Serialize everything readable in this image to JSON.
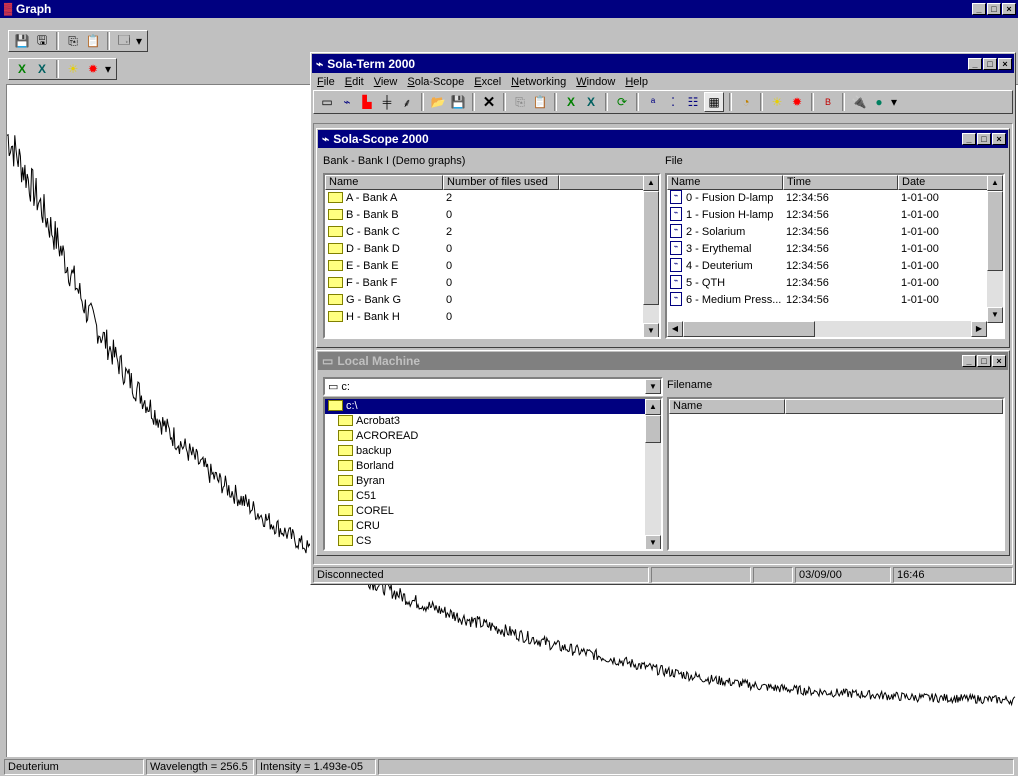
{
  "graph_window": {
    "title": "Graph",
    "status": {
      "series": "Deuterium",
      "wavelength": "Wavelength = 256.5",
      "intensity": "Intensity = 1.493e-05"
    }
  },
  "chart_data": {
    "type": "line",
    "title": "",
    "xlabel": "",
    "ylabel": "",
    "grid": false,
    "legend": "none",
    "series": [
      {
        "x": [
          0.0,
          0.02,
          0.05,
          0.08,
          0.12,
          0.16,
          0.2,
          0.25,
          0.3,
          0.35,
          0.4,
          0.45,
          0.5,
          0.55,
          0.6,
          0.65,
          0.7,
          0.75,
          0.8,
          0.85,
          0.9,
          0.95,
          1.0
        ],
        "values": [
          1.0,
          0.93,
          0.82,
          0.7,
          0.59,
          0.5,
          0.43,
          0.36,
          0.3,
          0.255,
          0.215,
          0.185,
          0.16,
          0.135,
          0.115,
          0.095,
          0.08,
          0.068,
          0.06,
          0.055,
          0.05,
          0.048,
          0.045
        ]
      }
    ]
  },
  "main_window": {
    "title": "Sola-Term 2000",
    "menu": [
      "File",
      "Edit",
      "View",
      "Sola-Scope",
      "Excel",
      "Networking",
      "Window",
      "Help"
    ],
    "status": {
      "connection": "Disconnected",
      "date": "03/09/00",
      "time": "16:46"
    }
  },
  "scope_window": {
    "title": "Sola-Scope 2000",
    "bank_label": "Bank - Bank I (Demo graphs)",
    "file_label": "File",
    "banks_columns": [
      "Name",
      "Number of files used"
    ],
    "banks": [
      {
        "name": "A - Bank A",
        "count": "2"
      },
      {
        "name": "B - Bank B",
        "count": "0"
      },
      {
        "name": "C - Bank C",
        "count": "2"
      },
      {
        "name": "D - Bank D",
        "count": "0"
      },
      {
        "name": "E - Bank E",
        "count": "0"
      },
      {
        "name": "F - Bank F",
        "count": "0"
      },
      {
        "name": "G - Bank G",
        "count": "0"
      },
      {
        "name": "H - Bank H",
        "count": "0"
      }
    ],
    "files_columns": [
      "Name",
      "Time",
      "Date"
    ],
    "files": [
      {
        "name": "0 - Fusion D-lamp",
        "time": "12:34:56",
        "date": "1-01-00"
      },
      {
        "name": "1 - Fusion H-lamp",
        "time": "12:34:56",
        "date": "1-01-00"
      },
      {
        "name": "2 - Solarium",
        "time": "12:34:56",
        "date": "1-01-00"
      },
      {
        "name": "3 - Erythemal",
        "time": "12:34:56",
        "date": "1-01-00"
      },
      {
        "name": "4 - Deuterium",
        "time": "12:34:56",
        "date": "1-01-00"
      },
      {
        "name": "5 - QTH",
        "time": "12:34:56",
        "date": "1-01-00"
      },
      {
        "name": "6 - Medium Press...",
        "time": "12:34:56",
        "date": "1-01-00"
      }
    ]
  },
  "local_window": {
    "title": "Local Machine",
    "drive": "c:",
    "filename_label": "Filename",
    "files_column": "Name",
    "root": "c:\\",
    "folders": [
      "Acrobat3",
      "ACROREAD",
      "backup",
      "Borland",
      "Byran",
      "C51",
      "COREL",
      "CRU",
      "CS"
    ]
  }
}
